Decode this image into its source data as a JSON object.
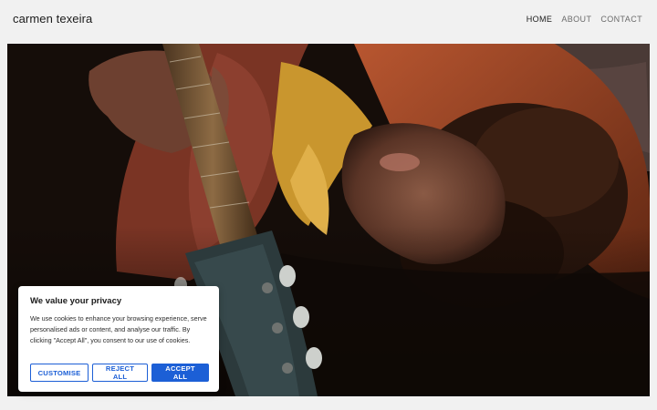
{
  "header": {
    "site_title": "carmen texeira",
    "nav": [
      {
        "label": "HOME",
        "active": true
      },
      {
        "label": "ABOUT",
        "active": false
      },
      {
        "label": "CONTACT",
        "active": false
      }
    ]
  },
  "hero": {
    "image_description": "person with curly hair lying down holding an acoustic guitar"
  },
  "cookie_banner": {
    "title": "We value your privacy",
    "text": "We use cookies to enhance your browsing experience, serve personalised ads or content, and analyse our traffic. By clicking \"Accept All\", you consent to our use of cookies.",
    "buttons": {
      "customise": "CUSTOMISE",
      "reject": "REJECT ALL",
      "accept": "ACCEPT ALL"
    }
  },
  "colors": {
    "accent": "#1c5fd6",
    "page_background": "#f1f1f1"
  }
}
